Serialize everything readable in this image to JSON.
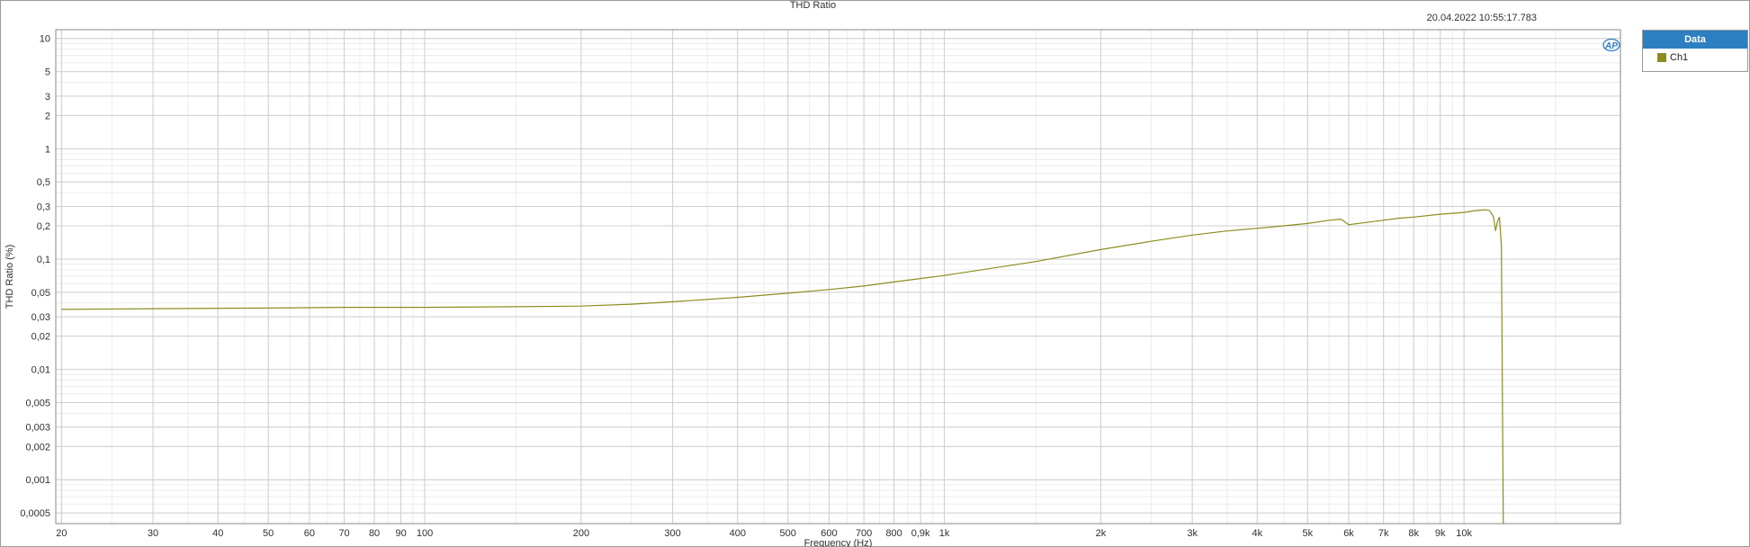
{
  "chart_data": {
    "type": "line",
    "title": "THD Ratio",
    "timestamp": "20.04.2022 10:55:17.783",
    "xlabel": "Frequency (Hz)",
    "ylabel": "THD Ratio (%)",
    "x_scale": "log",
    "y_scale": "log",
    "xlim": [
      19.5,
      20000
    ],
    "ylim": [
      0.0004,
      12
    ],
    "grid": true,
    "legend_title": "Data",
    "legend_placement": "right",
    "x_ticks": [
      {
        "v": 20,
        "t": "20"
      },
      {
        "v": 30,
        "t": "30"
      },
      {
        "v": 40,
        "t": "40"
      },
      {
        "v": 50,
        "t": "50"
      },
      {
        "v": 60,
        "t": "60"
      },
      {
        "v": 70,
        "t": "70"
      },
      {
        "v": 80,
        "t": "80"
      },
      {
        "v": 90,
        "t": "90"
      },
      {
        "v": 100,
        "t": "100"
      },
      {
        "v": 200,
        "t": "200"
      },
      {
        "v": 300,
        "t": "300"
      },
      {
        "v": 400,
        "t": "400"
      },
      {
        "v": 500,
        "t": "500"
      },
      {
        "v": 600,
        "t": "600"
      },
      {
        "v": 700,
        "t": "700"
      },
      {
        "v": 800,
        "t": "800"
      },
      {
        "v": 900,
        "t": "0,9k"
      },
      {
        "v": 1000,
        "t": "1k"
      },
      {
        "v": 2000,
        "t": "2k"
      },
      {
        "v": 3000,
        "t": "3k"
      },
      {
        "v": 4000,
        "t": "4k"
      },
      {
        "v": 5000,
        "t": "5k"
      },
      {
        "v": 6000,
        "t": "6k"
      },
      {
        "v": 7000,
        "t": "7k"
      },
      {
        "v": 8000,
        "t": "8k"
      },
      {
        "v": 9000,
        "t": "9k"
      },
      {
        "v": 10000,
        "t": "10k"
      }
    ],
    "y_ticks": [
      {
        "v": 10,
        "t": "10"
      },
      {
        "v": 5,
        "t": "5"
      },
      {
        "v": 3,
        "t": "3"
      },
      {
        "v": 2,
        "t": "2"
      },
      {
        "v": 1,
        "t": "1"
      },
      {
        "v": 0.5,
        "t": "0,5"
      },
      {
        "v": 0.3,
        "t": "0,3"
      },
      {
        "v": 0.2,
        "t": "0,2"
      },
      {
        "v": 0.1,
        "t": "0,1"
      },
      {
        "v": 0.05,
        "t": "0,05"
      },
      {
        "v": 0.03,
        "t": "0,03"
      },
      {
        "v": 0.02,
        "t": "0,02"
      },
      {
        "v": 0.01,
        "t": "0,01"
      },
      {
        "v": 0.005,
        "t": "0,005"
      },
      {
        "v": 0.003,
        "t": "0,003"
      },
      {
        "v": 0.002,
        "t": "0,002"
      },
      {
        "v": 0.001,
        "t": "0,001"
      },
      {
        "v": 0.0005,
        "t": "0,0005"
      }
    ],
    "series": [
      {
        "name": "Ch1",
        "color": "#8c8c1e",
        "x": [
          20,
          30,
          50,
          70,
          100,
          150,
          200,
          250,
          300,
          400,
          500,
          600,
          700,
          800,
          1000,
          1500,
          2000,
          2500,
          3000,
          3500,
          4000,
          4500,
          5000,
          5500,
          5800,
          6000,
          6500,
          7000,
          7500,
          8000,
          9000,
          10000,
          10500,
          11000,
          11200,
          11400,
          11500,
          11600,
          11700,
          11800,
          11900
        ],
        "y": [
          0.035,
          0.0355,
          0.036,
          0.0365,
          0.0365,
          0.037,
          0.0375,
          0.039,
          0.041,
          0.045,
          0.049,
          0.053,
          0.057,
          0.062,
          0.071,
          0.095,
          0.122,
          0.145,
          0.165,
          0.18,
          0.19,
          0.2,
          0.21,
          0.225,
          0.23,
          0.205,
          0.215,
          0.225,
          0.235,
          0.24,
          0.255,
          0.265,
          0.275,
          0.28,
          0.275,
          0.24,
          0.18,
          0.22,
          0.24,
          0.13,
          0.0004
        ]
      }
    ]
  },
  "watermark": "AP"
}
